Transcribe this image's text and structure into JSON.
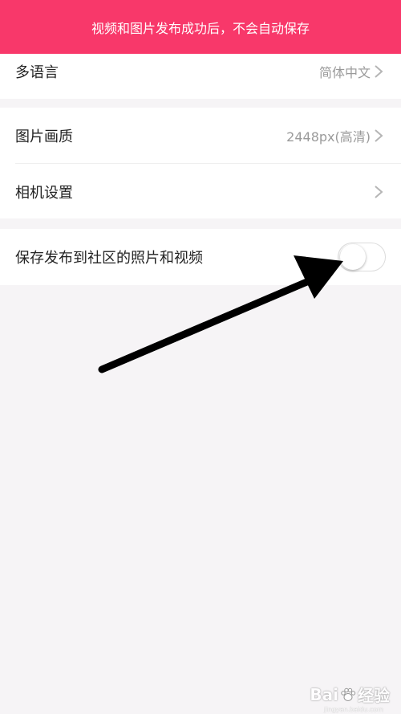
{
  "toast": {
    "message": "视频和图片发布成功后，不会自动保存",
    "color": "#f8386a"
  },
  "settings": {
    "language": {
      "label": "多语言",
      "value": "简体中文"
    },
    "image_quality": {
      "label": "图片画质",
      "value": "2448px(高清)"
    },
    "camera": {
      "label": "相机设置"
    },
    "save_community": {
      "label": "保存发布到社区的照片和视频",
      "toggle_on": false
    }
  },
  "annotation": {
    "arrow_color": "#000000"
  },
  "watermark": {
    "brand_left": "Bai",
    "brand_right": "经验",
    "sub": "jingyan.baidu.com"
  }
}
